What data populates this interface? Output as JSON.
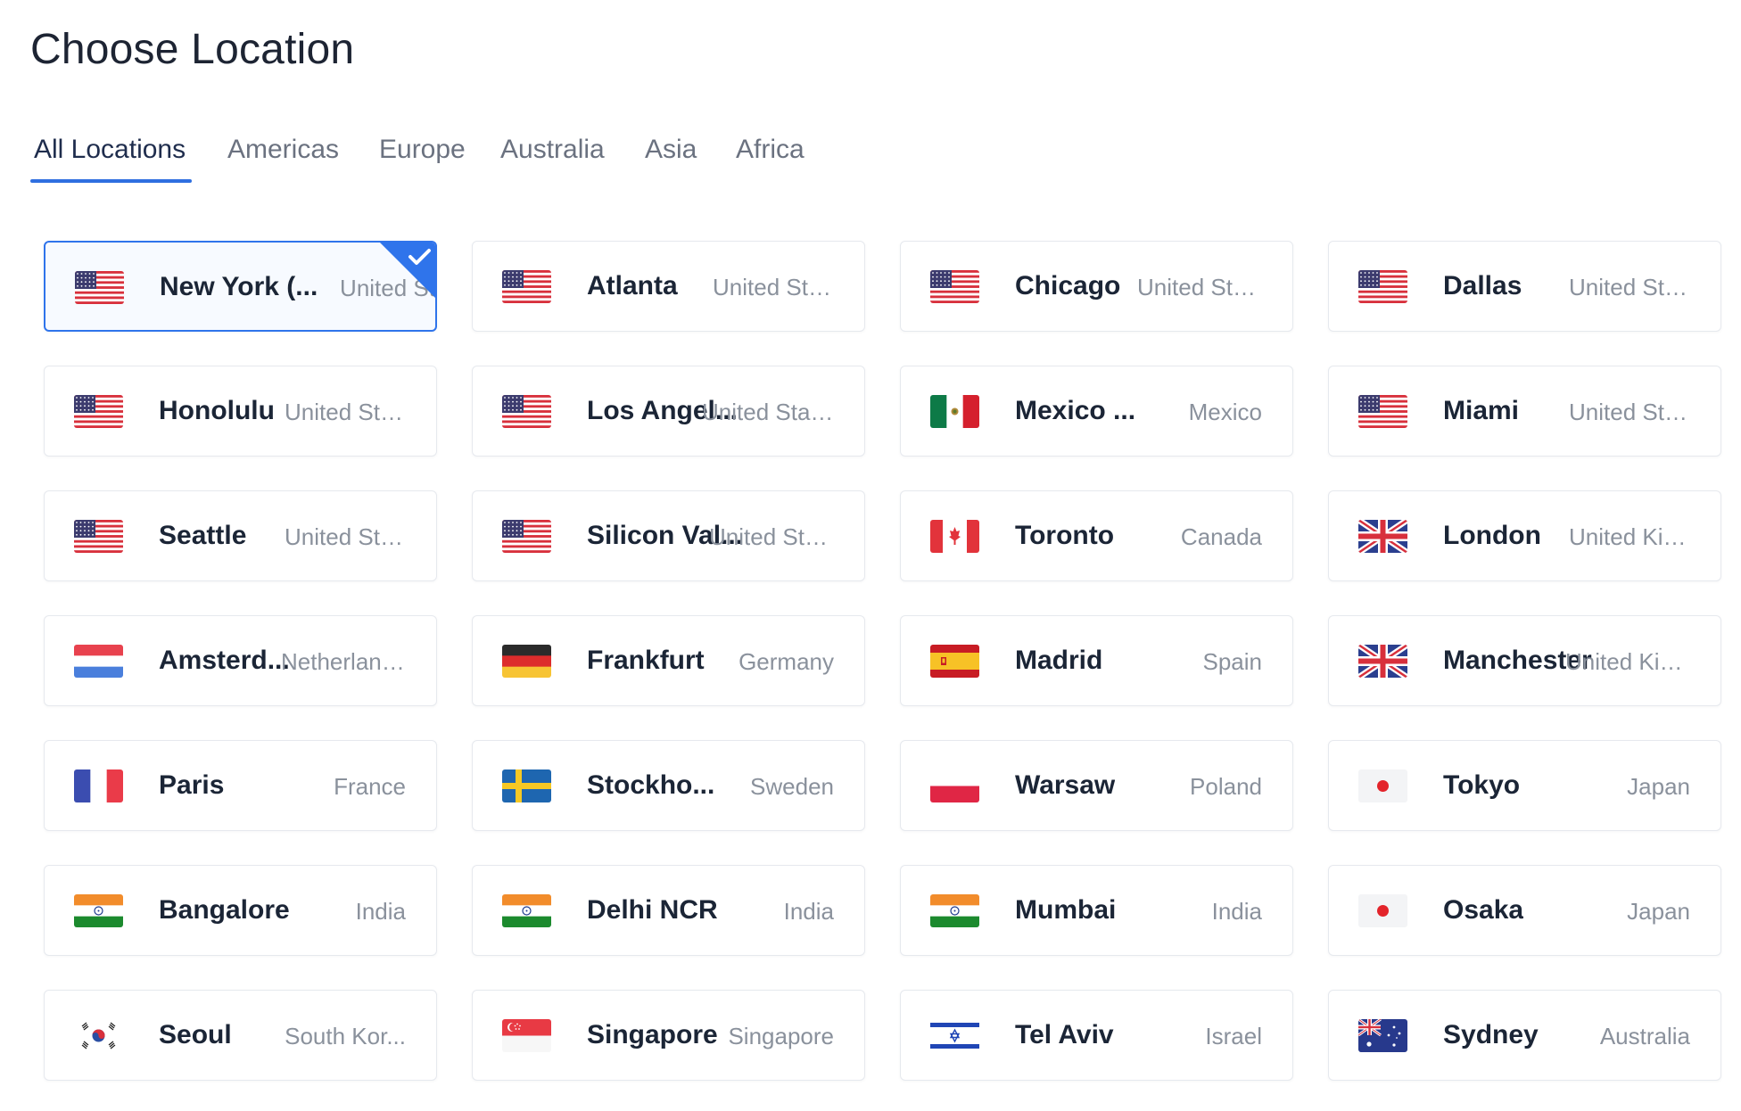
{
  "page_title": "Choose Location",
  "tabs": [
    {
      "label": "All Locations",
      "active": true
    },
    {
      "label": "Americas",
      "active": false
    },
    {
      "label": "Europe",
      "active": false
    },
    {
      "label": "Australia",
      "active": false
    },
    {
      "label": "Asia",
      "active": false
    },
    {
      "label": "Africa",
      "active": false
    }
  ],
  "locations": [
    {
      "city": "New York (...",
      "country": "United St",
      "flag": "us-flag-icon",
      "selected": true
    },
    {
      "city": "Atlanta",
      "country": "United Sta...",
      "flag": "us-flag-icon",
      "selected": false
    },
    {
      "city": "Chicago",
      "country": "United Sta...",
      "flag": "us-flag-icon",
      "selected": false
    },
    {
      "city": "Dallas",
      "country": "United Sta...",
      "flag": "us-flag-icon",
      "selected": false
    },
    {
      "city": "Honolulu",
      "country": "United Sta...",
      "flag": "us-flag-icon",
      "selected": false
    },
    {
      "city": "Los Angel...",
      "country": "United States",
      "flag": "us-flag-icon",
      "selected": false
    },
    {
      "city": "Mexico ...",
      "country": "Mexico",
      "flag": "mx-flag-icon",
      "selected": false
    },
    {
      "city": "Miami",
      "country": "United Sta...",
      "flag": "us-flag-icon",
      "selected": false
    },
    {
      "city": "Seattle",
      "country": "United Sta...",
      "flag": "us-flag-icon",
      "selected": false
    },
    {
      "city": "Silicon Val...",
      "country": "United State",
      "flag": "us-flag-icon",
      "selected": false
    },
    {
      "city": "Toronto",
      "country": "Canada",
      "flag": "ca-flag-icon",
      "selected": false
    },
    {
      "city": "London",
      "country": "United Kin...",
      "flag": "uk-flag-icon",
      "selected": false
    },
    {
      "city": "Amsterd...",
      "country": "Netherlands",
      "flag": "nl-flag-icon",
      "selected": false
    },
    {
      "city": "Frankfurt",
      "country": "Germany",
      "flag": "de-flag-icon",
      "selected": false
    },
    {
      "city": "Madrid",
      "country": "Spain",
      "flag": "es-flag-icon",
      "selected": false
    },
    {
      "city": "Manchester",
      "country": "United Kingd",
      "flag": "uk-flag-icon",
      "selected": false
    },
    {
      "city": "Paris",
      "country": "France",
      "flag": "fr-flag-icon",
      "selected": false
    },
    {
      "city": "Stockho...",
      "country": "Sweden",
      "flag": "se-flag-icon",
      "selected": false
    },
    {
      "city": "Warsaw",
      "country": "Poland",
      "flag": "pl-flag-icon",
      "selected": false
    },
    {
      "city": "Tokyo",
      "country": "Japan",
      "flag": "jp-flag-icon",
      "selected": false
    },
    {
      "city": "Bangalore",
      "country": "India",
      "flag": "in-flag-icon",
      "selected": false
    },
    {
      "city": "Delhi NCR",
      "country": "India",
      "flag": "in-flag-icon",
      "selected": false
    },
    {
      "city": "Mumbai",
      "country": "India",
      "flag": "in-flag-icon",
      "selected": false
    },
    {
      "city": "Osaka",
      "country": "Japan",
      "flag": "jp-flag-icon",
      "selected": false
    },
    {
      "city": "Seoul",
      "country": "South Kor...",
      "flag": "kr-flag-icon",
      "selected": false
    },
    {
      "city": "Singapore",
      "country": "Singapore",
      "flag": "sg-flag-icon",
      "selected": false
    },
    {
      "city": "Tel Aviv",
      "country": "Israel",
      "flag": "il-flag-icon",
      "selected": false
    },
    {
      "city": "Sydney",
      "country": "Australia",
      "flag": "au-flag-icon",
      "selected": false
    }
  ],
  "colors": {
    "accent": "#2f74eb",
    "title": "#1d2433",
    "city": "#1b2536",
    "country": "#8a919c",
    "tab_inactive": "#6b7280"
  }
}
